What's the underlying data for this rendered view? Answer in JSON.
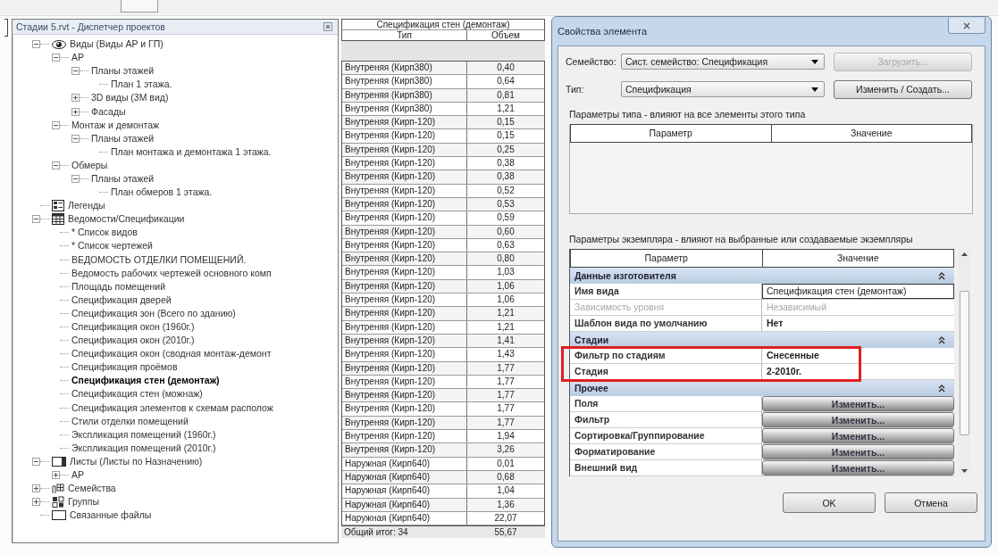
{
  "project_browser": {
    "title": "Стадии 5.rvt - Диспетчер проектов",
    "tree": [
      {
        "label": "Виды (Виды АР и ГП)",
        "kind": "views",
        "expanded": true,
        "selected": false,
        "children": [
          {
            "label": "АР",
            "expanded": true,
            "selected": false,
            "children": [
              {
                "label": "Планы этажей",
                "expanded": true,
                "selected": false,
                "children": [
                  {
                    "label": "План 1 этажа.",
                    "selected": false
                  }
                ]
              },
              {
                "label": "3D виды (3М вид)",
                "expanded": false,
                "selected": false
              },
              {
                "label": "Фасады",
                "expanded": false,
                "selected": false
              }
            ]
          },
          {
            "label": "Монтаж и демонтаж",
            "expanded": true,
            "selected": false,
            "children": [
              {
                "label": "Планы этажей",
                "expanded": true,
                "selected": false,
                "children": [
                  {
                    "label": "План монтажа и демонтажа 1 этажа.",
                    "selected": false
                  }
                ]
              }
            ]
          },
          {
            "label": "Обмеры",
            "expanded": true,
            "selected": false,
            "children": [
              {
                "label": "Планы этажей",
                "expanded": true,
                "selected": false,
                "children": [
                  {
                    "label": "План обмеров 1 этажа.",
                    "selected": false
                  }
                ]
              }
            ]
          }
        ]
      },
      {
        "label": "Легенды",
        "kind": "legends",
        "selected": false
      },
      {
        "label": "Ведомости/Спецификации",
        "kind": "schedules",
        "expanded": true,
        "selected": false,
        "children": [
          {
            "label": "* Список видов",
            "selected": false
          },
          {
            "label": "* Список чертежей",
            "selected": false
          },
          {
            "label": "ВЕДОМОСТЬ ОТДЕЛКИ ПОМЕЩЕНИЙ.",
            "selected": false
          },
          {
            "label": "Ведомость рабочих чертежей основного комп",
            "selected": false
          },
          {
            "label": "Площадь помещений",
            "selected": false
          },
          {
            "label": "Спецификация дверей",
            "selected": false
          },
          {
            "label": "Спецификация зон (Всего по зданию)",
            "selected": false
          },
          {
            "label": "Спецификация окон (1960г.)",
            "selected": false
          },
          {
            "label": "Спецификация окон (2010г.)",
            "selected": false
          },
          {
            "label": "Спецификация окон (сводная монтаж-демонт",
            "selected": false
          },
          {
            "label": "Спецификация проёмов",
            "selected": false
          },
          {
            "label": "Спецификация стен (демонтаж)",
            "selected": true
          },
          {
            "label": "Спецификация стен (можнаж)",
            "selected": false
          },
          {
            "label": "Спецификация элементов к схемам располож",
            "selected": false
          },
          {
            "label": "Стили отделки помещений",
            "selected": false
          },
          {
            "label": "Экспликация помещений (1960г.)",
            "selected": false
          },
          {
            "label": "Экспликация помещений (2010г.)",
            "selected": false
          }
        ]
      },
      {
        "label": "Листы (Листы по Назначению)",
        "kind": "sheets",
        "expanded": true,
        "selected": false,
        "children": [
          {
            "label": "АР",
            "expanded": false,
            "selected": false
          }
        ]
      },
      {
        "label": "Семейства",
        "kind": "families",
        "expanded": false,
        "selected": false
      },
      {
        "label": "Группы",
        "kind": "groups",
        "expanded": false,
        "selected": false
      },
      {
        "label": "Связанные файлы",
        "kind": "links",
        "selected": false
      }
    ]
  },
  "schedule": {
    "title": "Спецификация стен (демонтаж)",
    "columns": [
      "Тип",
      "Объем"
    ],
    "rows": [
      [
        "Внутреняя (Кирп380)",
        "0,40"
      ],
      [
        "Внутреняя (Кирп380)",
        "0,64"
      ],
      [
        "Внутреняя (Кирп380)",
        "0,81"
      ],
      [
        "Внутреняя (Кирп380)",
        "1,21"
      ],
      [
        "Внутреняя (Кирп-120)",
        "0,15"
      ],
      [
        "Внутреняя (Кирп-120)",
        "0,15"
      ],
      [
        "Внутреняя (Кирп-120)",
        "0,25"
      ],
      [
        "Внутреняя (Кирп-120)",
        "0,38"
      ],
      [
        "Внутреняя (Кирп-120)",
        "0,38"
      ],
      [
        "Внутреняя (Кирп-120)",
        "0,52"
      ],
      [
        "Внутреняя (Кирп-120)",
        "0,53"
      ],
      [
        "Внутреняя (Кирп-120)",
        "0,59"
      ],
      [
        "Внутреняя (Кирп-120)",
        "0,60"
      ],
      [
        "Внутреняя (Кирп-120)",
        "0,63"
      ],
      [
        "Внутреняя (Кирп-120)",
        "0,80"
      ],
      [
        "Внутреняя (Кирп-120)",
        "1,03"
      ],
      [
        "Внутреняя (Кирп-120)",
        "1,06"
      ],
      [
        "Внутреняя (Кирп-120)",
        "1,06"
      ],
      [
        "Внутреняя (Кирп-120)",
        "1,21"
      ],
      [
        "Внутреняя (Кирп-120)",
        "1,21"
      ],
      [
        "Внутреняя (Кирп-120)",
        "1,41"
      ],
      [
        "Внутреняя (Кирп-120)",
        "1,43"
      ],
      [
        "Внутреняя (Кирп-120)",
        "1,77"
      ],
      [
        "Внутреняя (Кирп-120)",
        "1,77"
      ],
      [
        "Внутреняя (Кирп-120)",
        "1,77"
      ],
      [
        "Внутреняя (Кирп-120)",
        "1,77"
      ],
      [
        "Внутреняя (Кирп-120)",
        "1,77"
      ],
      [
        "Внутреняя (Кирп-120)",
        "1,94"
      ],
      [
        "Внутреняя (Кирп-120)",
        "3,26"
      ],
      [
        "Наружная (Кирп640)",
        "0,01"
      ],
      [
        "Наружная (Кирп640)",
        "0,68"
      ],
      [
        "Наружная (Кирп640)",
        "1,04"
      ],
      [
        "Наружная (Кирп640)",
        "1,36"
      ],
      [
        "Наружная (Кирп640)",
        "22,07"
      ]
    ],
    "total": {
      "label": "Общий итог: 34",
      "value": "55,67"
    }
  },
  "dialog": {
    "title": "Свойства элемента",
    "family": {
      "label": "Семейство:",
      "value": "Сист. семейство: Спецификация",
      "button": {
        "label": "Загрузить...",
        "disabled": true
      }
    },
    "type": {
      "label": "Тип:",
      "value": "Спецификация",
      "button": {
        "label": "Изменить / Создать...",
        "disabled": false
      }
    },
    "type_params": {
      "caption": "Параметры типа - влияют на все элементы этого типа",
      "columns": [
        "Параметр",
        "Значение"
      ]
    },
    "instance_params": {
      "caption": "Параметры экземпляра - влияют на выбранные или создаваемые экземпляры",
      "columns": [
        "Параметр",
        "Значение"
      ],
      "rows": [
        {
          "kind": "group",
          "label": "Данные изготовителя",
          "expanded": true,
          "highlighted": false
        },
        {
          "kind": "input",
          "label": "Имя вида",
          "value": "Спецификация стен (демонтаж)",
          "highlighted": false
        },
        {
          "kind": "value",
          "label": "Зависимость уровня",
          "value": "Независимый",
          "disabled": true,
          "highlighted": false
        },
        {
          "kind": "value",
          "label": "Шаблон вида по умолчанию",
          "value": "Нет",
          "disabled": false,
          "highlighted": false
        },
        {
          "kind": "group",
          "label": "Стадии",
          "expanded": true,
          "highlighted": false
        },
        {
          "kind": "value",
          "label": "Фильтр по стадиям",
          "value": "Снесенные",
          "disabled": false,
          "highlighted": true
        },
        {
          "kind": "value",
          "label": "Стадия",
          "value": "2-2010г.",
          "disabled": false,
          "highlighted": true
        },
        {
          "kind": "group",
          "label": "Прочее",
          "expanded": true,
          "highlighted": false
        },
        {
          "kind": "button",
          "label": "Поля",
          "button": "Изменить...",
          "highlighted": false
        },
        {
          "kind": "button",
          "label": "Фильтр",
          "button": "Изменить...",
          "highlighted": false
        },
        {
          "kind": "button",
          "label": "Сортировка/Группирование",
          "button": "Изменить...",
          "highlighted": false
        },
        {
          "kind": "button",
          "label": "Форматирование",
          "button": "Изменить...",
          "highlighted": false
        },
        {
          "kind": "button",
          "label": "Внешний вид",
          "button": "Изменить...",
          "highlighted": false
        }
      ]
    },
    "buttons": [
      "OK",
      "Отмена"
    ]
  }
}
